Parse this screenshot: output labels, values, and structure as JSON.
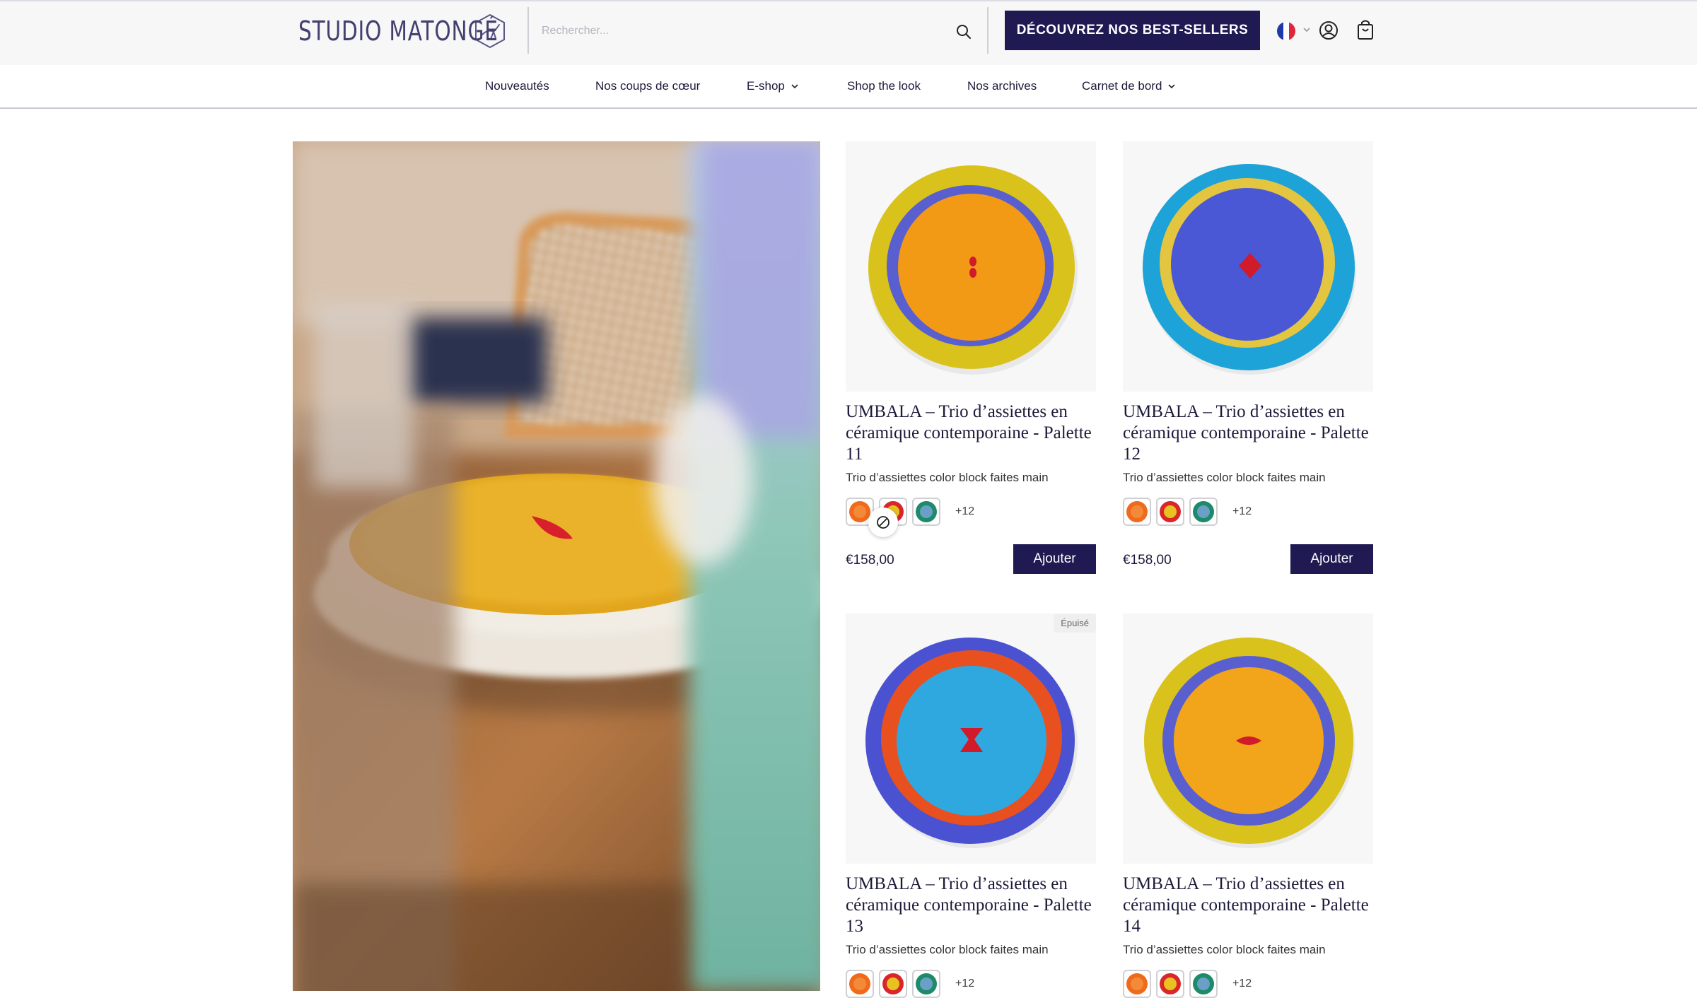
{
  "header": {
    "logo_text": "STUDIO MATONGÉ",
    "search_placeholder": "Rechercher...",
    "cta_label": "DÉCOUVREZ NOS BEST-SELLERS",
    "brand_color": "#1f1a52"
  },
  "nav": {
    "items": [
      {
        "label": "Nouveautés",
        "dropdown": false
      },
      {
        "label": "Nos coups de cœur",
        "dropdown": false
      },
      {
        "label": "E-shop",
        "dropdown": true
      },
      {
        "label": "Shop the look",
        "dropdown": false
      },
      {
        "label": "Nos archives",
        "dropdown": false
      },
      {
        "label": "Carnet de bord",
        "dropdown": true
      }
    ]
  },
  "products": [
    {
      "title": "UMBALA – Trio d’assiettes en céramique contemporaine - Palette 11",
      "subtitle": "Trio d’assiettes color block faites main",
      "more_swatches": "+12",
      "price": "€158,00",
      "add_label": "Ajouter",
      "badge": "",
      "colors": {
        "outer": "#d9c21b",
        "middle": "#5a5fd0",
        "inner": "#f29a16",
        "motif": "#d11a2a"
      }
    },
    {
      "title": "UMBALA – Trio d’assiettes en céramique contemporaine - Palette 12",
      "subtitle": "Trio d’assiettes color block faites main",
      "more_swatches": "+12",
      "price": "€158,00",
      "add_label": "Ajouter",
      "badge": "",
      "colors": {
        "outer": "#1ea3d8",
        "middle": "#e3c540",
        "inner": "#4a58d6",
        "motif": "#d11a2a"
      }
    },
    {
      "title": "UMBALA – Trio d’assiettes en céramique contemporaine - Palette 13",
      "subtitle": "Trio d’assiettes color block faites main",
      "more_swatches": "+12",
      "price": "",
      "add_label": "",
      "badge": "Épuisé",
      "colors": {
        "outer": "#4a52d2",
        "middle": "#e8501f",
        "inner": "#2fa8e0",
        "motif": "#d11a2a"
      }
    },
    {
      "title": "UMBALA – Trio d’assiettes en céramique contemporaine - Palette 14",
      "subtitle": "Trio d’assiettes color block faites main",
      "more_swatches": "+12",
      "price": "",
      "add_label": "",
      "badge": "",
      "colors": {
        "outer": "#d9c21b",
        "middle": "#5a5fd0",
        "inner": "#f2a51a",
        "motif": "#d11a2a"
      }
    }
  ],
  "swatch_colors": [
    {
      "outer": "#f06a1c",
      "inner": "#f38a3a"
    },
    {
      "outer": "#d8262c",
      "inner": "#e8c21e"
    },
    {
      "outer": "#1d8a6a",
      "inner": "#6aa0c8"
    }
  ]
}
